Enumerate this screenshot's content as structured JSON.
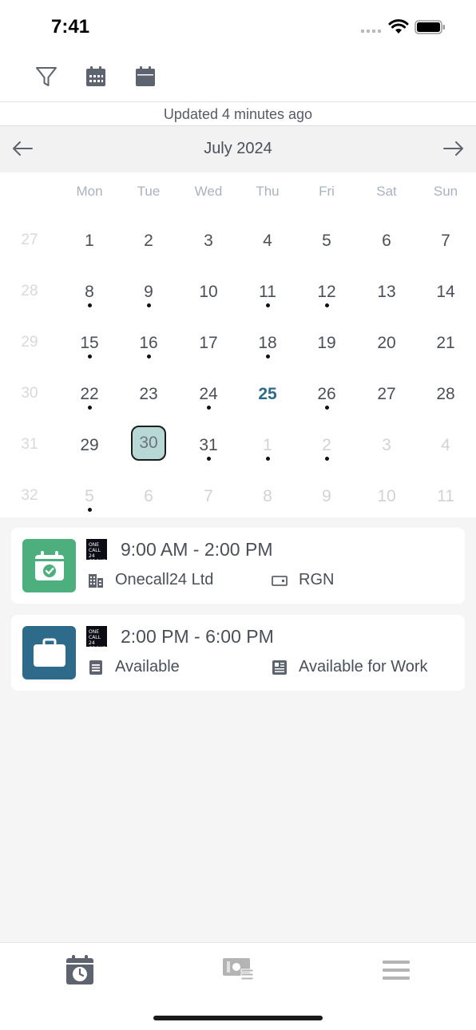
{
  "status": {
    "time": "7:41"
  },
  "updated_text": "Updated 4 minutes ago",
  "calendar": {
    "month_label": "July 2024",
    "weekdays": [
      "Mon",
      "Tue",
      "Wed",
      "Thu",
      "Fri",
      "Sat",
      "Sun"
    ],
    "weeks": [
      {
        "week": "27",
        "days": [
          {
            "d": "1"
          },
          {
            "d": "2"
          },
          {
            "d": "3"
          },
          {
            "d": "4"
          },
          {
            "d": "5"
          },
          {
            "d": "6"
          },
          {
            "d": "7"
          }
        ]
      },
      {
        "week": "28",
        "days": [
          {
            "d": "8",
            "dot": true
          },
          {
            "d": "9",
            "dot": true
          },
          {
            "d": "10"
          },
          {
            "d": "11",
            "dot": true
          },
          {
            "d": "12",
            "dot": true
          },
          {
            "d": "13"
          },
          {
            "d": "14"
          }
        ]
      },
      {
        "week": "29",
        "days": [
          {
            "d": "15",
            "dot": true
          },
          {
            "d": "16",
            "dot": true
          },
          {
            "d": "17"
          },
          {
            "d": "18",
            "dot": true
          },
          {
            "d": "19"
          },
          {
            "d": "20"
          },
          {
            "d": "21"
          }
        ]
      },
      {
        "week": "30",
        "days": [
          {
            "d": "22",
            "dot": true
          },
          {
            "d": "23"
          },
          {
            "d": "24",
            "dot": true
          },
          {
            "d": "25",
            "today": true
          },
          {
            "d": "26",
            "dot": true
          },
          {
            "d": "27"
          },
          {
            "d": "28"
          }
        ]
      },
      {
        "week": "31",
        "days": [
          {
            "d": "29"
          },
          {
            "d": "30",
            "selected": true
          },
          {
            "d": "31",
            "dot": true
          },
          {
            "d": "1",
            "out": true,
            "dot": true
          },
          {
            "d": "2",
            "out": true,
            "dot": true
          },
          {
            "d": "3",
            "out": true
          },
          {
            "d": "4",
            "out": true
          }
        ]
      },
      {
        "week": "32",
        "days": [
          {
            "d": "5",
            "out": true,
            "dot": true
          },
          {
            "d": "6",
            "out": true
          },
          {
            "d": "7",
            "out": true
          },
          {
            "d": "8",
            "out": true
          },
          {
            "d": "9",
            "out": true
          },
          {
            "d": "10",
            "out": true
          },
          {
            "d": "11",
            "out": true
          }
        ]
      }
    ]
  },
  "events": [
    {
      "time": "9:00 AM - 2:00 PM",
      "icon": "calendar-check-icon",
      "color": "#4caf7d",
      "left_icon": "building-icon",
      "left_text": "Onecall24 Ltd",
      "right_icon": "tag-icon",
      "right_text": "RGN",
      "logo_text": "ONE CALL 24 GROUP"
    },
    {
      "time": "2:00 PM - 6:00 PM",
      "icon": "briefcase-icon",
      "color": "#2e6a8a",
      "left_icon": "document-icon",
      "left_text": "Available",
      "right_icon": "newspaper-icon",
      "right_text": "Available for Work",
      "logo_text": "ONE CALL 24 GROUP"
    }
  ],
  "colors": {
    "accent": "#2e6a8a",
    "selected_bg": "#b8d8d6",
    "success": "#4caf7d"
  }
}
